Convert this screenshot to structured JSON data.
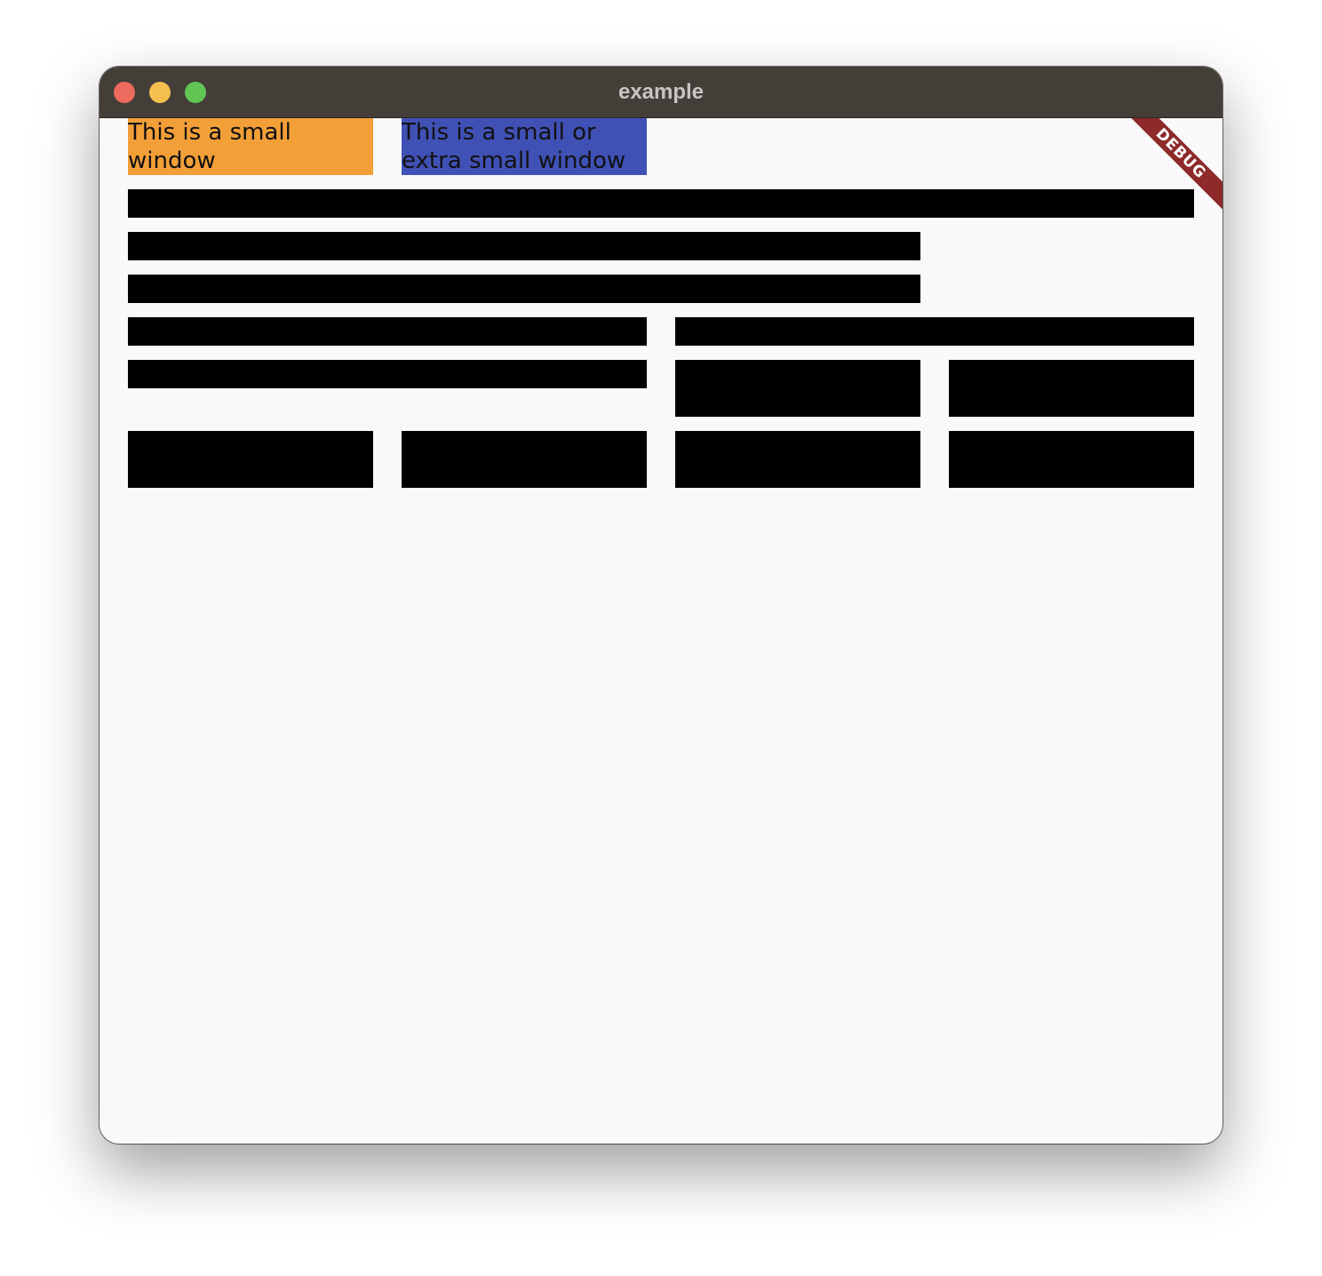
{
  "window": {
    "title": "example",
    "controls": {
      "close_color": "#ec6a5e",
      "minimize_color": "#f4bf4f",
      "zoom_color": "#61c554"
    }
  },
  "boxes": {
    "small": {
      "text": "This is a small window",
      "color": "#f39f38"
    },
    "small_or_extra_small": {
      "text": "This is a small or extra small window",
      "color": "#4051b5"
    }
  },
  "debug_banner": {
    "label": "DEBUG",
    "color": "#8e2a2a"
  }
}
